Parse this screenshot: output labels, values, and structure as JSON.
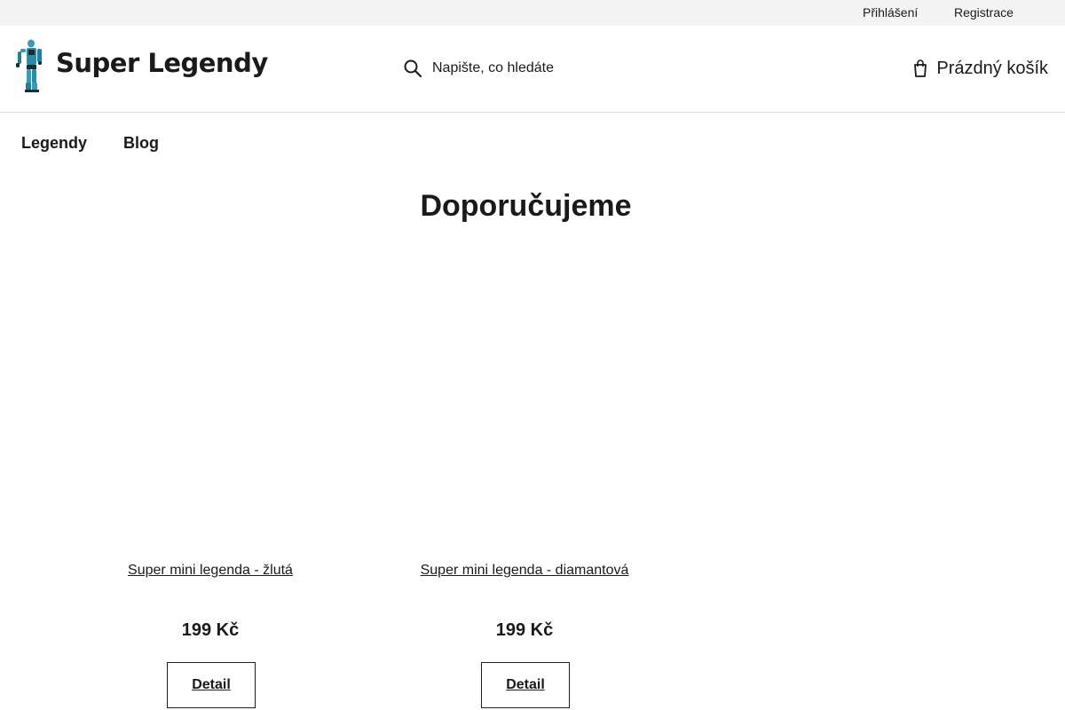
{
  "topbar": {
    "login_label": "Přihlášení",
    "register_label": "Registrace"
  },
  "header": {
    "logo_text": "Super Legendy",
    "search_placeholder": "Napište, co hledáte",
    "cart_label": "Prázdný košík"
  },
  "nav": {
    "items": [
      {
        "label": "Legendy"
      },
      {
        "label": "Blog"
      }
    ]
  },
  "main": {
    "section_title": "Doporučujeme",
    "products": [
      {
        "name": "Super mini legenda - žlutá",
        "price": "199 Kč",
        "button_label": "Detail"
      },
      {
        "name": "Super mini legenda - diamantová",
        "price": "199 Kč",
        "button_label": "Detail"
      }
    ]
  },
  "icons": {
    "search": "search-icon",
    "cart": "cart-icon",
    "logo": "action-figure-logo-icon"
  },
  "colors": {
    "text": "#1a1a1a",
    "topbar_bg": "#f4f4f4",
    "logo_figure": "#3a9bb5"
  }
}
